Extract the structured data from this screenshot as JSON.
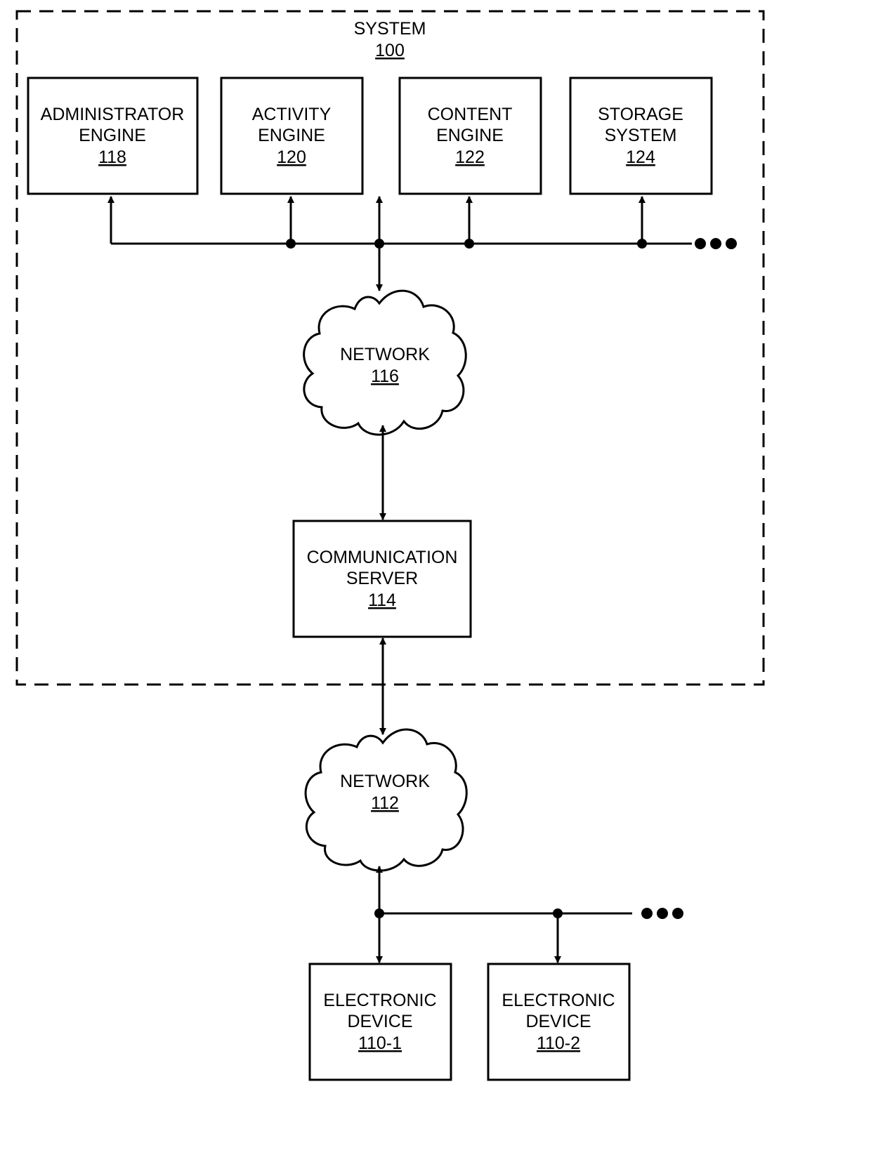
{
  "system": {
    "title": "SYSTEM",
    "ref": "100"
  },
  "components": {
    "administrator_engine": {
      "line1": "ADMINISTRATOR",
      "line2": "ENGINE",
      "ref": "118"
    },
    "activity_engine": {
      "line1": "ACTIVITY",
      "line2": "ENGINE",
      "ref": "120"
    },
    "content_engine": {
      "line1": "CONTENT",
      "line2": "ENGINE",
      "ref": "122"
    },
    "storage_system": {
      "line1": "STORAGE",
      "line2": "SYSTEM",
      "ref": "124"
    },
    "network_116": {
      "line1": "NETWORK",
      "ref": "116"
    },
    "communication_server": {
      "line1": "COMMUNICATION",
      "line2": "SERVER",
      "ref": "114"
    },
    "network_112": {
      "line1": "NETWORK",
      "ref": "112"
    },
    "electronic_device_1": {
      "line1": "ELECTRONIC",
      "line2": "DEVICE",
      "ref": "110-1"
    },
    "electronic_device_2": {
      "line1": "ELECTRONIC",
      "line2": "DEVICE",
      "ref": "110-2"
    }
  },
  "edges": [
    {
      "from": "bus",
      "to": "administrator_engine",
      "direction": "to"
    },
    {
      "from": "bus",
      "to": "activity_engine",
      "direction": "to"
    },
    {
      "from": "bus",
      "to": "content_engine",
      "direction": "to"
    },
    {
      "from": "bus",
      "to": "storage_system",
      "direction": "to"
    },
    {
      "from": "bus",
      "to": "network_116",
      "direction": "bidirectional"
    },
    {
      "from": "network_116",
      "to": "communication_server",
      "direction": "bidirectional"
    },
    {
      "from": "communication_server",
      "to": "network_112",
      "direction": "bidirectional"
    },
    {
      "from": "network_112",
      "to": "electronic_device_1",
      "direction": "bidirectional"
    },
    {
      "from": "network_112",
      "to": "electronic_device_2",
      "direction": "to"
    }
  ],
  "continuation": "..."
}
